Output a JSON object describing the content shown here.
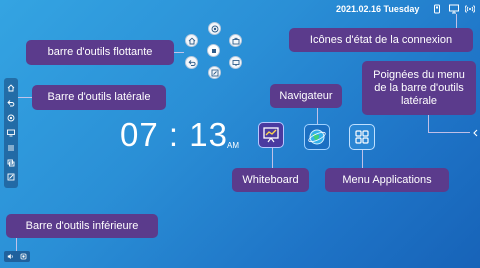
{
  "status_bar": {
    "datetime": "2021.02.16 Tuesday",
    "icons": [
      "storage-icon",
      "screen-share-icon",
      "wireless-icon"
    ]
  },
  "clock": {
    "time": "07 : 13",
    "period": "AM"
  },
  "annotations": {
    "floating_toolbar": "barre d'outils flottante",
    "connection_icons": "Icônes d'état de la connexion",
    "side_toolbar": "Barre d'outils latérale",
    "navigator": "Navigateur",
    "side_handles": "Poignées du menu de la barre d'outils latérale",
    "whiteboard": "Whiteboard",
    "apps_menu": "Menu Applications",
    "bottom_toolbar": "Barre d'outils inférieure"
  },
  "colors": {
    "label_bg": "#5b3b8c",
    "background_start": "#34a4e2",
    "background_end": "#1763b8"
  },
  "apps": [
    {
      "name": "whiteboard",
      "icon": "whiteboard-icon"
    },
    {
      "name": "navigator",
      "icon": "globe-icon"
    },
    {
      "name": "applications",
      "icon": "apps-grid-icon"
    }
  ],
  "floating_toolbar_icons": [
    "target-icon",
    "home-icon",
    "briefcase-icon",
    "square-stop-icon",
    "back-icon",
    "monitor-icon",
    "edit-icon"
  ],
  "side_toolbar_icons": [
    "home-icon",
    "back-icon",
    "settings-icon",
    "monitor-icon",
    "list-icon",
    "windows-icon",
    "edit-icon"
  ],
  "bottom_toolbar_icons": [
    "volume-icon",
    "record-icon"
  ]
}
